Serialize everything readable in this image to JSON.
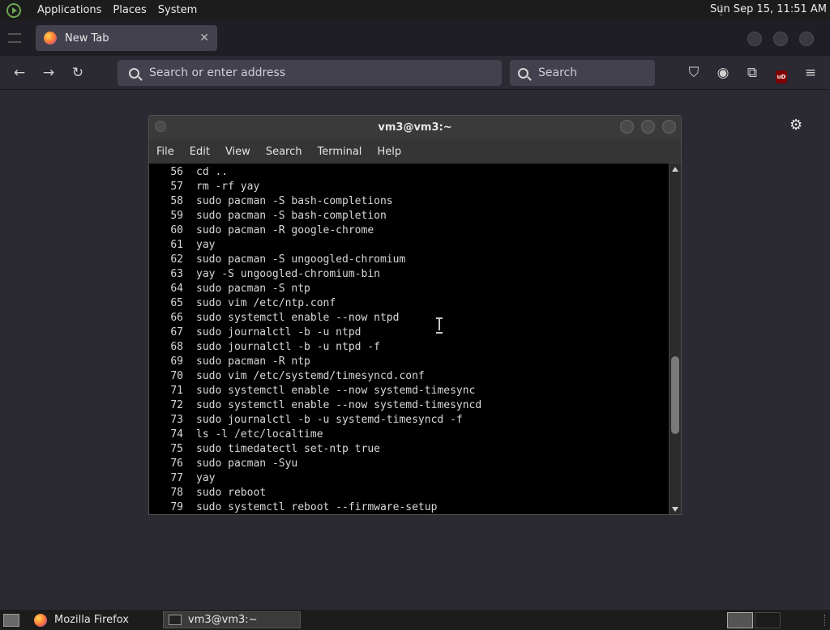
{
  "top_panel": {
    "menu": [
      "Applications",
      "Places",
      "System"
    ],
    "clock": "Sun Sep 15, 11:51 AM"
  },
  "browser": {
    "tab_title": "New Tab",
    "tab_close": "✕",
    "url_placeholder": "Search or enter address",
    "search_placeholder": "Search",
    "ublock_label": "uD"
  },
  "terminal": {
    "title": "vm3@vm3:~",
    "menu": [
      "File",
      "Edit",
      "View",
      "Search",
      "Terminal",
      "Help"
    ],
    "lines": [
      {
        "n": "56",
        "cmd": "cd .."
      },
      {
        "n": "57",
        "cmd": "rm -rf yay"
      },
      {
        "n": "58",
        "cmd": "sudo pacman -S bash-completions"
      },
      {
        "n": "59",
        "cmd": "sudo pacman -S bash-completion"
      },
      {
        "n": "60",
        "cmd": "sudo pacman -R google-chrome"
      },
      {
        "n": "61",
        "cmd": "yay"
      },
      {
        "n": "62",
        "cmd": "sudo pacman -S ungoogled-chromium"
      },
      {
        "n": "63",
        "cmd": "yay -S ungoogled-chromium-bin"
      },
      {
        "n": "64",
        "cmd": "sudo pacman -S ntp"
      },
      {
        "n": "65",
        "cmd": "sudo vim /etc/ntp.conf"
      },
      {
        "n": "66",
        "cmd": "sudo systemctl enable --now ntpd"
      },
      {
        "n": "67",
        "cmd": "sudo journalctl -b -u ntpd"
      },
      {
        "n": "68",
        "cmd": "sudo journalctl -b -u ntpd -f"
      },
      {
        "n": "69",
        "cmd": "sudo pacman -R ntp"
      },
      {
        "n": "70",
        "cmd": "sudo vim /etc/systemd/timesyncd.conf"
      },
      {
        "n": "71",
        "cmd": "sudo systemctl enable --now systemd-timesync"
      },
      {
        "n": "72",
        "cmd": "sudo systemctl enable --now systemd-timesyncd"
      },
      {
        "n": "73",
        "cmd": "sudo journalctl -b -u systemd-timesyncd -f"
      },
      {
        "n": "74",
        "cmd": "ls -l /etc/localtime"
      },
      {
        "n": "75",
        "cmd": "sudo timedatectl set-ntp true"
      },
      {
        "n": "76",
        "cmd": "sudo pacman -Syu"
      },
      {
        "n": "77",
        "cmd": "yay"
      },
      {
        "n": "78",
        "cmd": "sudo reboot"
      },
      {
        "n": "79",
        "cmd": "sudo systemctl reboot --firmware-setup"
      }
    ]
  },
  "taskbar": {
    "tasks": [
      {
        "label": "Mozilla Firefox",
        "icon": "firefox-icon"
      },
      {
        "label": "vm3@vm3:~",
        "icon": "terminal-icon"
      }
    ]
  }
}
